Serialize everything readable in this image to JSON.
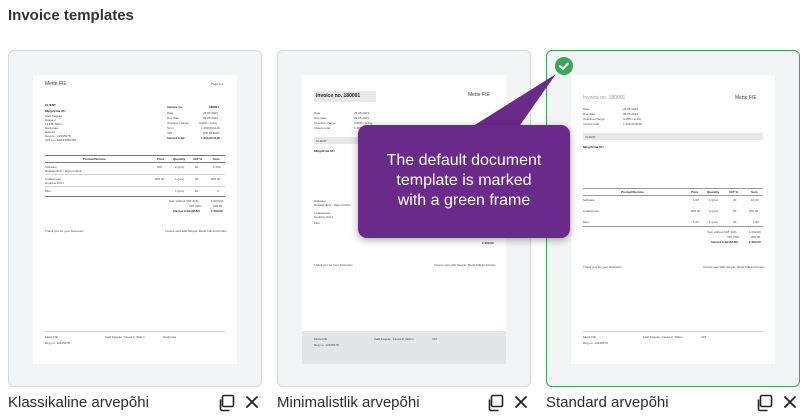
{
  "page": {
    "title": "Invoice templates"
  },
  "templates": [
    {
      "name": "Klassikaline arvepõhi",
      "doc": {
        "company": "Mette FIE",
        "page_no": "Page 1/1",
        "client_head": "CLIENT",
        "client_name": "Mingifirma OÜ",
        "client_lines": [
          "Kadi Kegeler",
          "Kassa 2",
          "12345 Tallinn",
          "Harjumaa",
          "Estonia",
          "Reg no.: 12345678",
          "VAT no.: EE123456789"
        ],
        "info_title": "Invoice no.",
        "info_number": "180001",
        "info_labels": [
          "Date",
          "Due date",
          "Overdue charge",
          "Term",
          "VAT",
          "Invoice total"
        ],
        "info_values": [
          "26.05.2023",
          "09.06.2023",
          "0,05% / a day",
          "1 000,00 EUR",
          "200,00 EUR",
          "1 200,00 EUR"
        ],
        "table_head": [
          "Product/Service",
          "Price",
          "Quantity",
          "VAT %",
          "Sum"
        ],
        "rows": [
          [
            "Software",
            "Reklaamibid – Digio ümbrik",
            "500",
            "2 (pcs)",
            "20",
            "1 000"
          ],
          [
            "Lisateenuse",
            "Hooldus OÜH",
            "500,00",
            "1 (pcs)",
            "20",
            "500,00"
          ],
          [
            "Muu",
            "",
            "",
            "1 (pcs)",
            "20",
            "0"
          ]
        ],
        "totals": [
          "Sum without VAT 20%",
          "VAT 20%",
          "Invoice total (EUR)"
        ],
        "totals_values": [
          "1 000,00",
          "200,00",
          "1 200,00"
        ],
        "thanks": "Thank you for your business!",
        "powered": "Invoice sent with Simple, Mette FIE and Fotios",
        "footer": [
          "Mette FIE",
          "Reg no. 12345678",
          "Kadi Kegeler, Kassa 2, Tallinn",
          "Harjumaa",
          "e-mail",
          "mette@example.ee"
        ]
      }
    },
    {
      "name": "Minimalistlik arvepõhi",
      "doc": {
        "title": "Invoice no. 180001",
        "company": "Mette FIE",
        "client_head": "CLIENT",
        "client_name": "Mingifirma OÜ",
        "info_labels": [
          "Date",
          "Due date",
          "Overdue charge",
          "Invoice total"
        ],
        "info_values": [
          "26.05.2023",
          "09.06.2023",
          "0,05% / a day",
          "1 200,00 EUR"
        ],
        "totals_values": [
          "1 000,00",
          "200,00",
          "1 200,00"
        ],
        "rows": [
          [
            "Software",
            "Reklaamibid – Digio ümbrik"
          ],
          [
            "Lisateenuse",
            "Hooldus OÜH"
          ],
          [
            "Muu",
            ""
          ]
        ],
        "thanks": "Thank you for your business!",
        "powered": "Invoice sent with Simple, Mette FIE and Fotios",
        "footer": [
          "Mette FIE",
          "Kadi Kegeler, Kassa 2, Tallinn",
          "Reg no. 12345678",
          "VAT"
        ]
      }
    },
    {
      "name": "Standard arvepõhi",
      "doc": {
        "title": "Invoice no. 180001",
        "company": "Mette FIE",
        "client_head": "CLIENT",
        "client_name": "Mingifirma OÜ",
        "info_labels": [
          "Date",
          "Due date",
          "Overdue charge",
          "Invoice total"
        ],
        "info_values": [
          "26.05.2023",
          "09.06.2023",
          "0,05% / a day",
          "1 200,00 EUR"
        ],
        "table_head": [
          "Product/Service",
          "Price",
          "Quantity",
          "VAT %",
          "Sum"
        ],
        "rows": [
          [
            "Software",
            "1,00",
            "1 (pcs)",
            "20",
            "10,00"
          ],
          [
            "Lisateenuse",
            "500,00",
            "2 (pcs)",
            "20",
            "500,00"
          ],
          [
            "Muu",
            "1,00",
            "1 (pcs)",
            "20",
            "1,00"
          ]
        ],
        "totals": [
          "Sum without VAT 20%",
          "VAT 20%",
          "Invoice total (EUR)"
        ],
        "totals_values": [
          "1 000,00",
          "200,00",
          "1 200,00"
        ],
        "thanks": "Thank you for your business!",
        "powered": "Invoice sent with Simple, Mette FIE and Fotios",
        "footer": [
          "Mette FIE",
          "Kadi Kegeler, Kassa 2, Tallinn",
          "Reg no. 12345678",
          "VAT"
        ]
      }
    }
  ],
  "selected_index": 2,
  "tooltip": {
    "text": "The default document\ntemplate is marked\nwith a green frame"
  },
  "colors": {
    "selected_border": "#3aa65a",
    "tooltip_bg": "#6a2a8a"
  },
  "icons": {
    "copy": "copy-icon",
    "close": "close-icon",
    "check": "check-icon"
  }
}
